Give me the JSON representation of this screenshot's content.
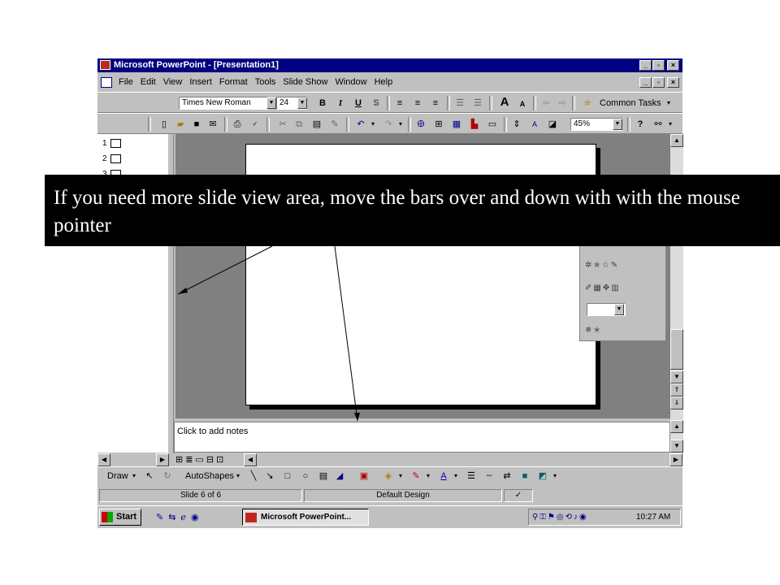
{
  "window": {
    "title": "Microsoft PowerPoint - [Presentation1]",
    "caption_buttons": [
      "_",
      "▫",
      "×"
    ]
  },
  "menu": {
    "items": [
      "File",
      "Edit",
      "View",
      "Insert",
      "Format",
      "Tools",
      "Slide Show",
      "Window",
      "Help"
    ]
  },
  "formatting_toolbar": {
    "font": "Times New Roman",
    "size": "24",
    "bold": "B",
    "italic": "I",
    "underline": "U",
    "shadow": "S",
    "common_tasks": "Common Tasks"
  },
  "standard_toolbar": {
    "zoom": "45%"
  },
  "outline": {
    "slides": [
      "1",
      "2",
      "3"
    ]
  },
  "notes": {
    "placeholder": "Click to add notes"
  },
  "draw_toolbar": {
    "draw": "Draw",
    "autoshapes": "AutoShapes"
  },
  "status": {
    "slide": "Slide 6 of 6",
    "design": "Default Design"
  },
  "taskbar": {
    "start": "Start",
    "task": "Microsoft PowerPoint...",
    "clock": "10:27 AM"
  },
  "callout": {
    "text": "If you need more slide view area, move the bars over and down with with the mouse pointer"
  },
  "colors": {
    "title_bar": "#000080",
    "face": "#c0c0c0",
    "workspace": "#808080",
    "callout_bg": "#000000"
  }
}
